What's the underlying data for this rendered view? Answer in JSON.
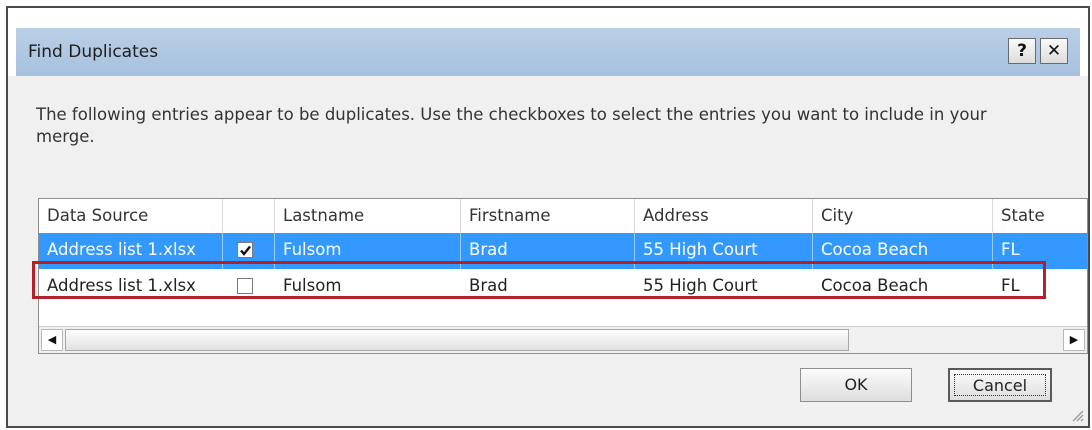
{
  "window": {
    "title": "Find Duplicates",
    "help_label": "?",
    "close_label": "✕"
  },
  "prompt": "The following entries appear to be duplicates. Use the checkboxes to select the entries you want to include in your merge.",
  "table": {
    "columns": [
      "Data Source",
      "",
      "Lastname",
      "Firstname",
      "Address",
      "City",
      "State"
    ],
    "rows": [
      {
        "data_source": "Address list 1.xlsx",
        "checked": true,
        "lastname": "Fulsom",
        "firstname": "Brad",
        "address": "55 High Court",
        "city": "Cocoa Beach",
        "state": "FL",
        "selected": true
      },
      {
        "data_source": "Address list 1.xlsx",
        "checked": false,
        "lastname": "Fulsom",
        "firstname": "Brad",
        "address": "55 High Court",
        "city": "Cocoa Beach",
        "state": "FL",
        "selected": false
      }
    ]
  },
  "buttons": {
    "ok": "OK",
    "cancel": "Cancel"
  },
  "colors": {
    "selection": "#3399ff",
    "highlight_box": "#b2202a",
    "title_band": "#a7c1de"
  },
  "icons": [
    "help-icon",
    "close-icon",
    "checkmark-icon",
    "scroll-left-icon",
    "scroll-right-icon",
    "resize-grip-icon"
  ]
}
